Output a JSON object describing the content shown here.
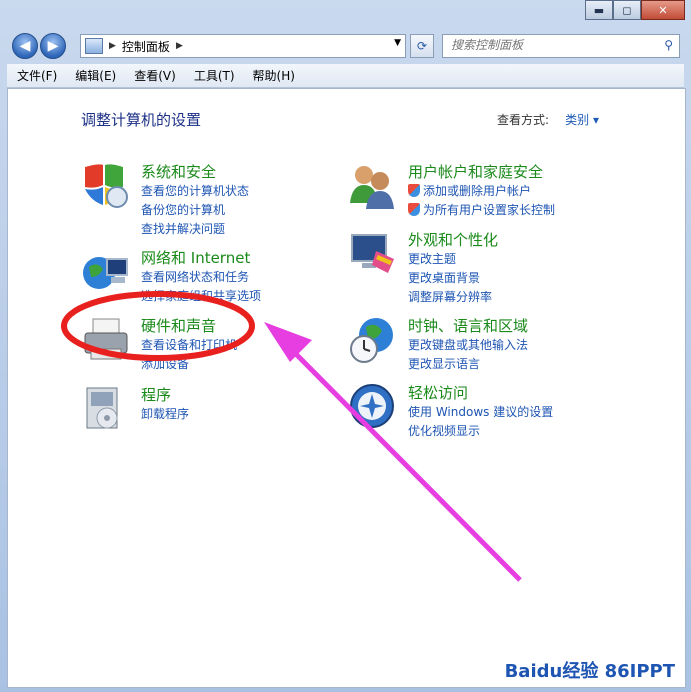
{
  "window": {
    "minimize": "▬",
    "maximize": "◻",
    "close": "✕"
  },
  "nav": {
    "back": "◀",
    "forward": "▶",
    "breadcrumb": "控制面板",
    "search_placeholder": "搜索控制面板"
  },
  "menu": [
    "文件(F)",
    "编辑(E)",
    "查看(V)",
    "工具(T)",
    "帮助(H)"
  ],
  "header": {
    "title": "调整计算机的设置",
    "view_label": "查看方式:",
    "view_value": "类别 ▾"
  },
  "categories": {
    "system": {
      "title": "系统和安全",
      "links": [
        "查看您的计算机状态",
        "备份您的计算机",
        "查找并解决问题"
      ]
    },
    "network": {
      "title": "网络和 Internet",
      "links": [
        "查看网络状态和任务",
        "选择家庭组和共享选项"
      ]
    },
    "hardware": {
      "title": "硬件和声音",
      "links": [
        "查看设备和打印机",
        "添加设备"
      ]
    },
    "programs": {
      "title": "程序",
      "links": [
        "卸载程序"
      ]
    },
    "users": {
      "title": "用户帐户和家庭安全",
      "links": [
        "添加或删除用户帐户",
        "为所有用户设置家长控制"
      ]
    },
    "appearance": {
      "title": "外观和个性化",
      "links": [
        "更改主题",
        "更改桌面背景",
        "调整屏幕分辨率"
      ]
    },
    "clock": {
      "title": "时钟、语言和区域",
      "links": [
        "更改键盘或其他输入法",
        "更改显示语言"
      ]
    },
    "ease": {
      "title": "轻松访问",
      "links": [
        "使用 Windows 建议的设置",
        "优化视频显示"
      ]
    }
  },
  "watermark": "Baidu经验 86IPPT"
}
